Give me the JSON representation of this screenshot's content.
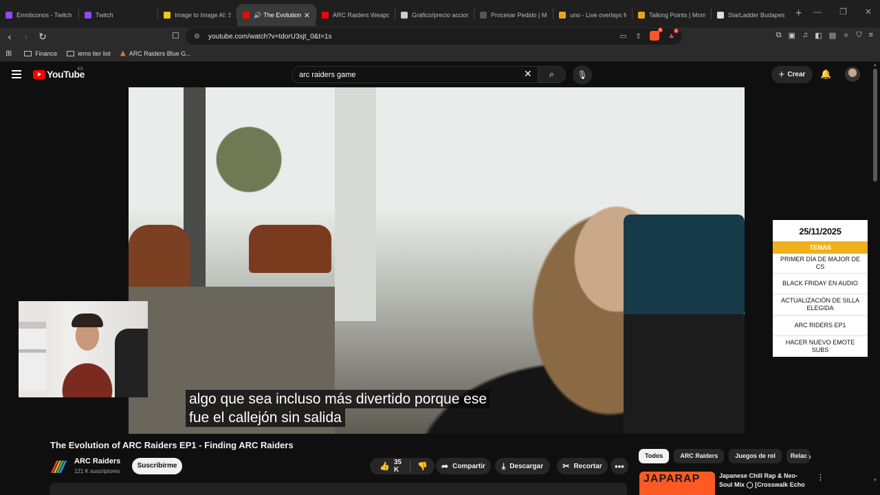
{
  "browser": {
    "tabs": [
      {
        "title": "Emoticonos - Twitch",
        "color": "#9146ff"
      },
      {
        "title": "Twitch",
        "color": "#9146ff"
      },
      {
        "title": "Image to Image AI: Sm",
        "color": "#f5c518"
      },
      {
        "title": "The Evolution o",
        "color": "#ff0000",
        "active": true
      },
      {
        "title": "ARC Raiders Weapon T",
        "color": "#ff0000"
      },
      {
        "title": "Gráfico/precio accione",
        "color": "#cccccc"
      },
      {
        "title": "Procesar Pedido | Muni",
        "color": "#555555"
      },
      {
        "title": "uno - Live overlays for",
        "color": "#f0a020"
      },
      {
        "title": "Talking Points | Mome",
        "color": "#f0a020"
      },
      {
        "title": "StarLadder Budapest M",
        "color": "#dddddd"
      }
    ],
    "url": "youtube.com/watch?v=tdorU3sjt_0&t=1s",
    "bookmarks": [
      "Finance",
      "iems tier list",
      "ARC Raiders Blue G..."
    ],
    "brave_badge": "6",
    "alert_badge": "1"
  },
  "youtube": {
    "logo": "YouTube",
    "country": "ES",
    "search_query": "arc raiders game",
    "create_label": "Crear"
  },
  "video": {
    "subtitle_line1": "algo que sea incluso más divertido porque ese",
    "subtitle_line2": "fue el callejón sin salida",
    "title": "The Evolution of ARC Raiders EP1 - Finding ARC Raiders"
  },
  "topics_panel": {
    "date": "25/11/2025",
    "header": "TEMAS",
    "items": [
      "PRIMER DÍA DE MAJOR DE CS",
      "BLACK FRIDAY EN AUDIO",
      "ACTUALIZACIÓN DE SILLA ELEGIDA",
      "ARC RIDERS EP1",
      "HACER NUEVO EMOTE SUBS"
    ],
    "accent": "#f0b01c"
  },
  "channel": {
    "name": "ARC Raiders",
    "subscribers": "121 K suscriptores",
    "subscribe_label": "Suscribirme"
  },
  "actions": {
    "likes": "35 K",
    "share": "Compartir",
    "download": "Descargar",
    "clip": "Recortar"
  },
  "chips": [
    "Todos",
    "ARC Raiders",
    "Juegos de rol",
    "Relac"
  ],
  "recommendation": {
    "thumb_text": "JAPARAP",
    "title": "Japanese Chill Rap & Neo-Soul Mix ◯ [Crosswalk Echo"
  }
}
